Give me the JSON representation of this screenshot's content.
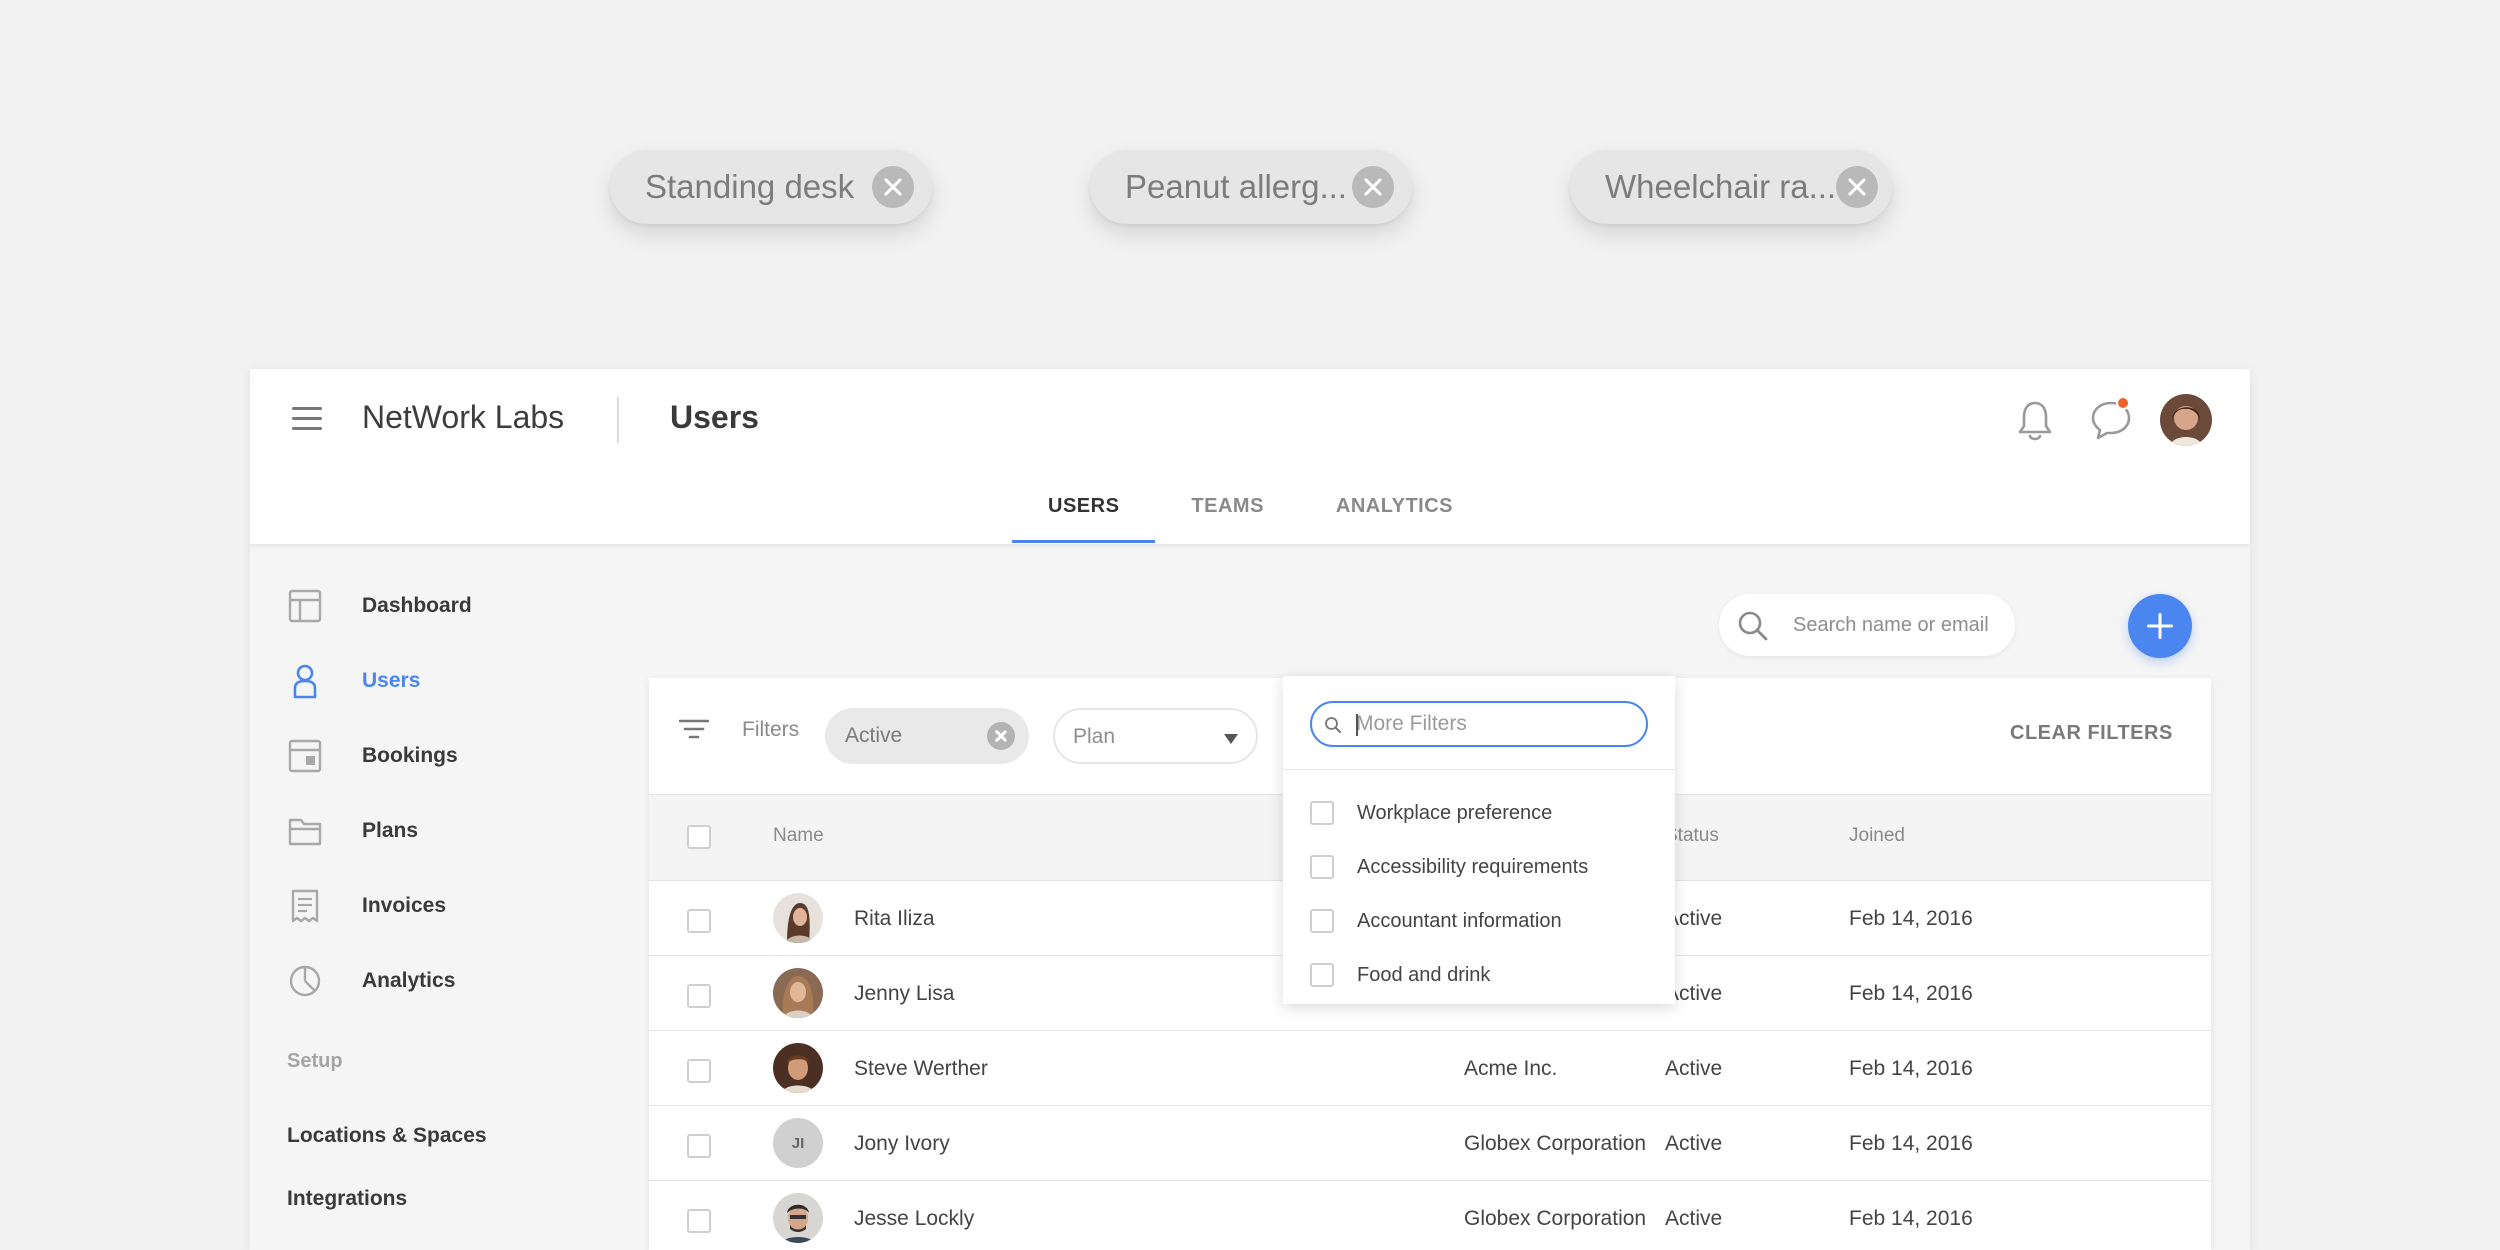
{
  "floating_chips": [
    {
      "label": "Standing desk"
    },
    {
      "label": "Peanut allerg..."
    },
    {
      "label": "Wheelchair ra..."
    }
  ],
  "header": {
    "brand": "NetWork Labs",
    "title": "Users"
  },
  "tabs": [
    {
      "label": "USERS"
    },
    {
      "label": "TEAMS"
    },
    {
      "label": "ANALYTICS"
    }
  ],
  "sidebar": {
    "items": [
      {
        "label": "Dashboard",
        "icon": "dashboard-icon"
      },
      {
        "label": "Users",
        "icon": "user-icon"
      },
      {
        "label": "Bookings",
        "icon": "bookings-icon"
      },
      {
        "label": "Plans",
        "icon": "folder-icon"
      },
      {
        "label": "Invoices",
        "icon": "invoice-icon"
      },
      {
        "label": "Analytics",
        "icon": "pie-chart-icon"
      }
    ],
    "setup_label": "Setup",
    "setup_links": [
      {
        "label": "Locations & Spaces"
      },
      {
        "label": "Integrations"
      }
    ]
  },
  "search": {
    "placeholder": "Search name or email"
  },
  "filters": {
    "label": "Filters",
    "active_chip": "Active",
    "plan_placeholder": "Plan",
    "clear": "CLEAR FILTERS"
  },
  "more_filters": {
    "placeholder": "More Filters",
    "options": [
      {
        "label": "Workplace preference"
      },
      {
        "label": "Accessibility requirements"
      },
      {
        "label": "Accountant information"
      },
      {
        "label": "Food and drink"
      }
    ]
  },
  "table": {
    "headers": {
      "name": "Name",
      "status": "Status",
      "joined": "Joined"
    },
    "rows": [
      {
        "name": "Rita Iliza",
        "company": "",
        "status": "Active",
        "joined": "Feb 14, 2016"
      },
      {
        "name": "Jenny Lisa",
        "company": "",
        "status": "Active",
        "joined": "Feb 14, 2016"
      },
      {
        "name": "Steve Werther",
        "company": "Acme Inc.",
        "status": "Active",
        "joined": "Feb 14, 2016"
      },
      {
        "name": "Jony Ivory",
        "initials": "JI",
        "company": "Globex Corporation",
        "status": "Active",
        "joined": "Feb 14, 2016"
      },
      {
        "name": "Jesse Lockly",
        "company": "Globex Corporation",
        "status": "Active",
        "joined": "Feb 14, 2016"
      }
    ]
  },
  "colors": {
    "accent": "#4a85f0",
    "notification": "#f0622a"
  }
}
